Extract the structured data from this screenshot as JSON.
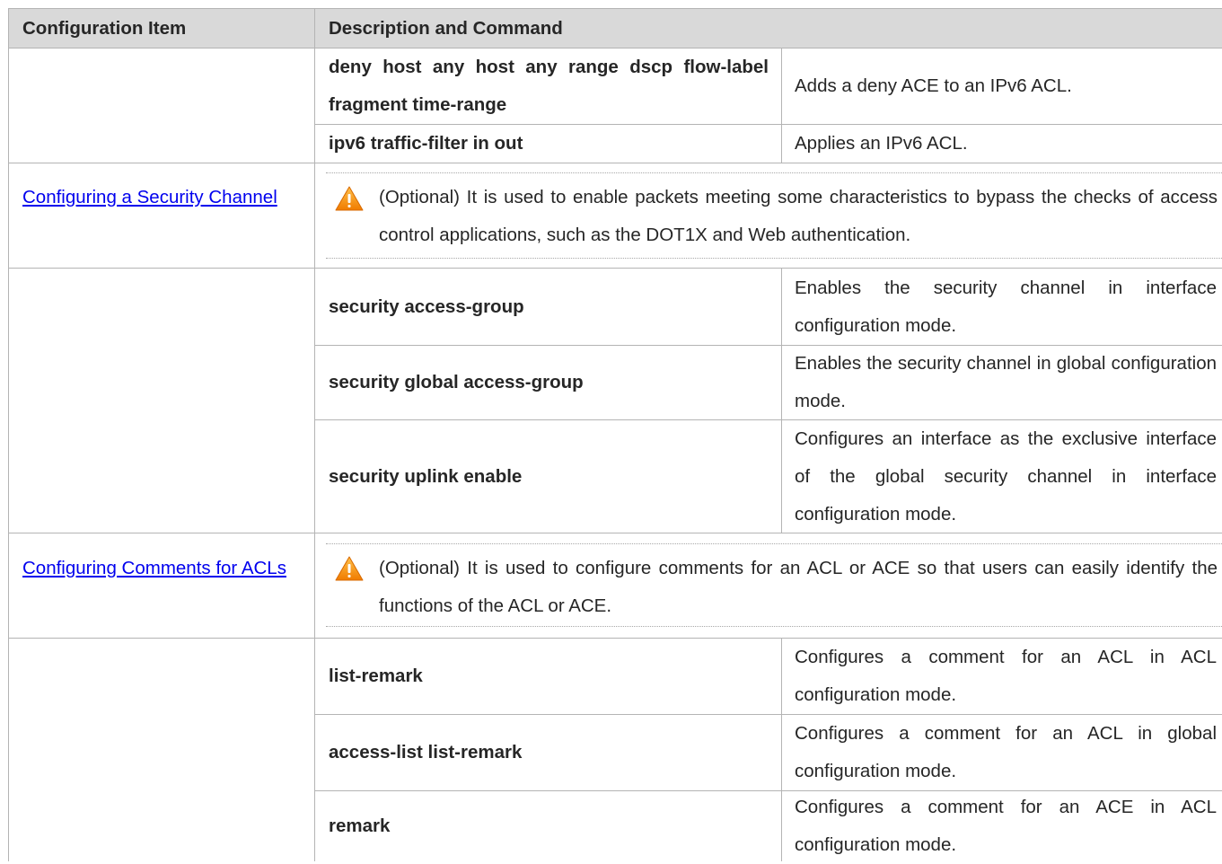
{
  "header": {
    "col1": "Configuration Item",
    "col2": "Description and Command"
  },
  "ipv6_rows": [
    {
      "command": "deny host any host any range dscp flow-label fragment time-range",
      "description": "Adds a deny ACE to an IPv6 ACL."
    },
    {
      "command": "ipv6 traffic-filter in out",
      "description": "Applies an IPv6 ACL."
    }
  ],
  "security_channel": {
    "item_link": "Configuring a Security Channel",
    "note": "(Optional) It is used to enable packets meeting some characteristics to bypass the checks of access control applications, such as the DOT1X and Web authentication.",
    "icon": "warning-icon",
    "rows": [
      {
        "command": "security access-group",
        "description": "Enables the security channel in interface configuration mode."
      },
      {
        "command": "security global access-group",
        "description": "Enables the security channel in global configuration mode."
      },
      {
        "command": "security uplink enable",
        "description": "Configures an interface as the exclusive interface of the global security channel in interface configuration mode."
      }
    ]
  },
  "comments": {
    "item_link": "Configuring Comments for ACLs",
    "note": "(Optional) It is used to configure comments for an ACL or ACE so that users can easily identify the functions of the ACL or ACE.",
    "icon": "warning-icon",
    "rows": [
      {
        "command": "list-remark",
        "description": "Configures a comment for an ACL in ACL configuration mode."
      },
      {
        "command": "access-list list-remark",
        "description": "Configures a comment for an ACL in global configuration mode."
      },
      {
        "command": "remark",
        "description": "Configures a comment for an ACE in ACL configuration mode."
      }
    ]
  },
  "colors": {
    "header_bg": "#d9d9d9",
    "border": "#b4b4b4",
    "link": "#0000ee",
    "warning_orange": "#f39c12"
  }
}
